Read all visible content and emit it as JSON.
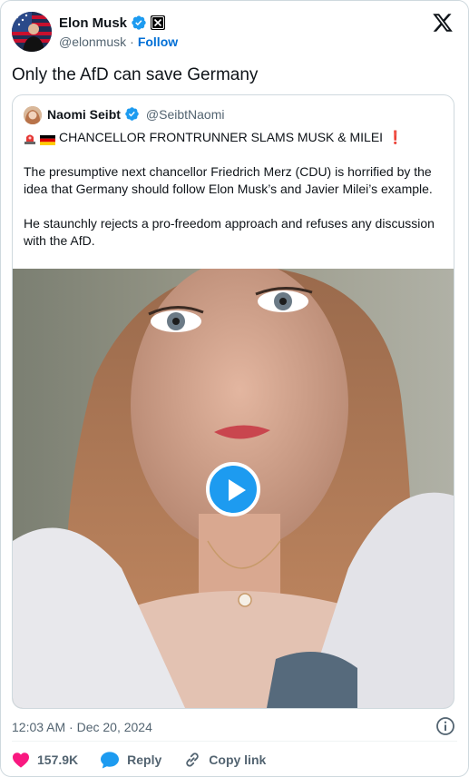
{
  "author": {
    "name": "Elon Musk",
    "handle": "@elonmusk",
    "separator": "·",
    "follow_label": "Follow"
  },
  "tweet": {
    "text": "Only the AfD can save Germany",
    "timestamp": "12:03 AM · Dec 20, 2024"
  },
  "quote": {
    "name": "Naomi Seibt",
    "handle": "@SeibtNaomi",
    "headline": "CHANCELLOR FRONTRUNNER SLAMS MUSK & MILEI",
    "exclamation": "❗",
    "paragraph1": "The presumptive next chancellor Friedrich Merz (CDU) is horrified by the idea that Germany should follow Elon Musk’s and Javier Milei’s example.",
    "paragraph2": "He staunchly rejects a pro-freedom approach and refuses any discussion with the AfD."
  },
  "actions": {
    "likes": "157.9K",
    "reply_label": "Reply",
    "copy_link_label": "Copy link"
  },
  "colors": {
    "link_blue": "#006fd6",
    "verified_blue": "#1d9bf0",
    "like_red": "#f91880",
    "muted": "#536471",
    "text": "#0f1419",
    "border": "#cfd9de"
  },
  "icons": {
    "header": [
      "verified-badge-icon",
      "x-affiliation-icon",
      "x-logo-icon"
    ],
    "footer": [
      "info-icon",
      "heart-icon",
      "reply-bubble-icon",
      "link-icon"
    ],
    "media": "play-icon"
  }
}
